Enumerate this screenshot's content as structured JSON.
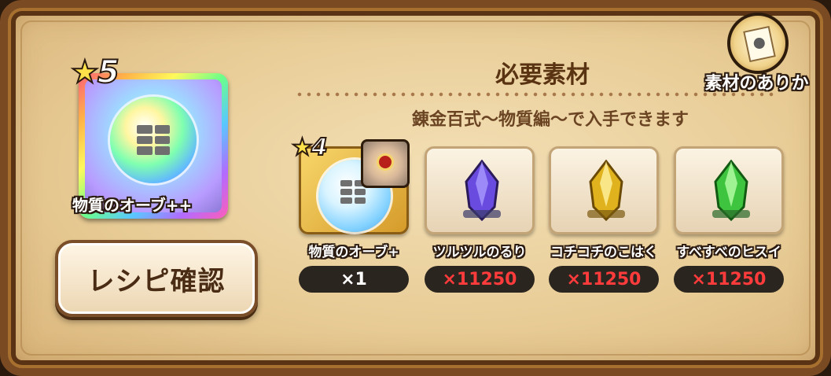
{
  "header": {
    "title": "必要素材",
    "subtitle": "錬金百式〜物質編〜で入手できます"
  },
  "where_button": {
    "label": "素材のありか",
    "icon": "scroll-icon"
  },
  "result_item": {
    "rank": "5",
    "name": "物質のオーブ++",
    "icon": "rainbow-orb-icon"
  },
  "recipe_button": {
    "label": "レシピ確認"
  },
  "materials": [
    {
      "rank": "4",
      "name": "物質のオーブ+",
      "quantity": "×1",
      "icon": "orb-icon",
      "qty_color": "#ffffff"
    },
    {
      "name": "ツルツルのるり",
      "quantity": "×11250",
      "icon": "purple-crystal-icon",
      "crystal_color": "#6a4be0",
      "qty_color": "#ff3b3b"
    },
    {
      "name": "コチコチのこはく",
      "quantity": "×11250",
      "icon": "amber-crystal-icon",
      "crystal_color": "#e0b21e",
      "qty_color": "#ff3b3b"
    },
    {
      "name": "すべすべのヒスイ",
      "quantity": "×11250",
      "icon": "jade-crystal-icon",
      "crystal_color": "#3ec43e",
      "qty_color": "#ff3b3b"
    }
  ]
}
